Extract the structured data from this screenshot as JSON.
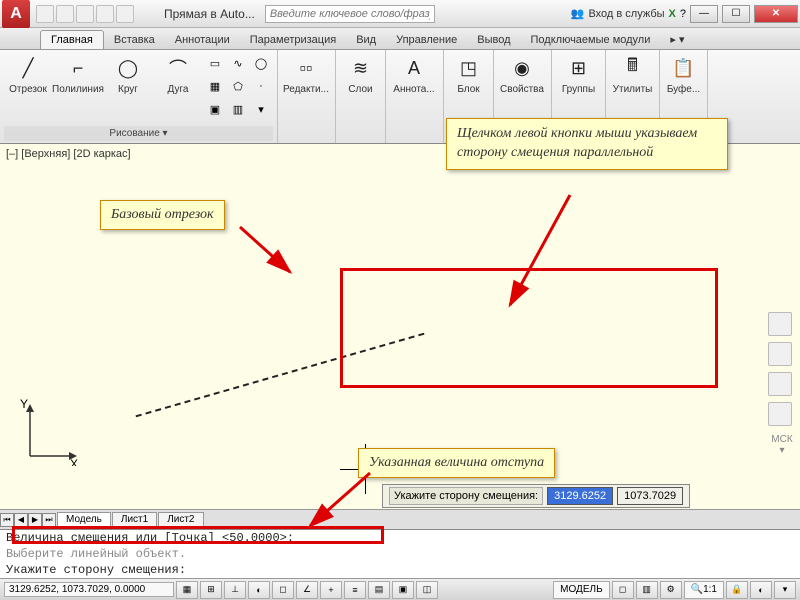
{
  "title": "Прямая в Auto...",
  "search_placeholder": "Введите ключевое слово/фразу",
  "login": "Вход в службы",
  "tabs": {
    "home": "Главная",
    "insert": "Вставка",
    "annotate": "Аннотации",
    "parametric": "Параметризация",
    "view": "Вид",
    "manage": "Управление",
    "output": "Вывод",
    "plugins": "Подключаемые модули"
  },
  "tools": {
    "line": "Отрезок",
    "polyline": "Полилиния",
    "circle": "Круг",
    "arc": "Дуга",
    "edit": "Редакти...",
    "layers": "Слои",
    "annot": "Аннота...",
    "block": "Блок",
    "props": "Свойства",
    "groups": "Группы",
    "utils": "Утилиты",
    "buffer": "Буфе..."
  },
  "panel_draw": "Рисование ▾",
  "viewport_label": "[–] [Верхняя] [2D каркас]",
  "dyn": {
    "prompt": "Укажите сторону смещения:",
    "x": "3129.6252",
    "y": "1073.7029"
  },
  "ucs_x": "X",
  "ucs_y": "Y",
  "layout": {
    "model": "Модель",
    "sheet1": "Лист1",
    "sheet2": "Лист2"
  },
  "cmd": {
    "l1": "Величина смещения или [Точка] <50.0000>:",
    "l2": "Выберите линейный объект.",
    "l3": "Укажите сторону смещения:"
  },
  "status": {
    "coords": "3129.6252, 1073.7029, 0.0000",
    "model": "МОДЕЛЬ",
    "scale": "1:1"
  },
  "callouts": {
    "base": "Базовый отрезок",
    "side": "Щелчком левой кнопки мыши указываем сторону смещения параллельной",
    "offset": "Указанная величина отступа"
  },
  "msk": "МСК ▾"
}
